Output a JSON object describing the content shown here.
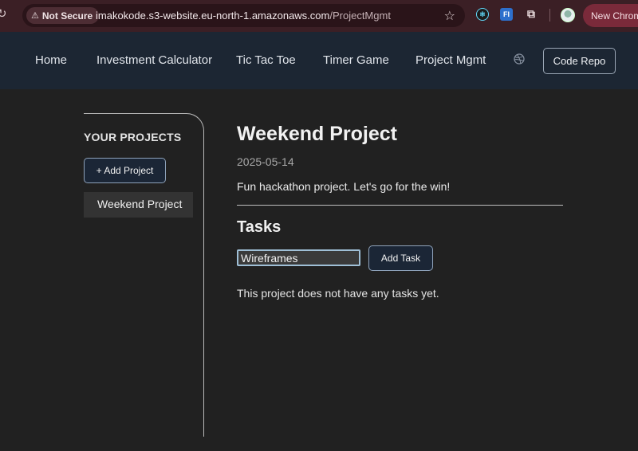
{
  "browser": {
    "security_label": "Not Secure",
    "url_host": "imakokode.s3-website.eu-north-1.amazonaws.com",
    "url_path": "/ProjectMgmt",
    "profile_label": "New Chrom",
    "extension_fi_label": "FI"
  },
  "nav": {
    "links": [
      "Home",
      "Investment Calculator",
      "Tic Tac Toe",
      "Timer Game",
      "Project Mgmt"
    ],
    "repo_button": "Code Repo"
  },
  "sidebar": {
    "heading": "YOUR PROJECTS",
    "add_button": "+ Add Project",
    "projects": [
      "Weekend Project"
    ]
  },
  "project": {
    "title": "Weekend Project",
    "date": "2025-05-14",
    "description": "Fun hackathon project. Let's go for the win!"
  },
  "tasks": {
    "heading": "Tasks",
    "input_value": "Wireframes",
    "add_button": "Add Task",
    "empty_message": "This project does not have any tasks yet."
  },
  "colors": {
    "page_bg": "#212121",
    "nav_bg": "#1c2633",
    "chrome_bg": "#3b1f25",
    "button_bg": "#1b2636",
    "accent_border": "#9fbfd6"
  }
}
